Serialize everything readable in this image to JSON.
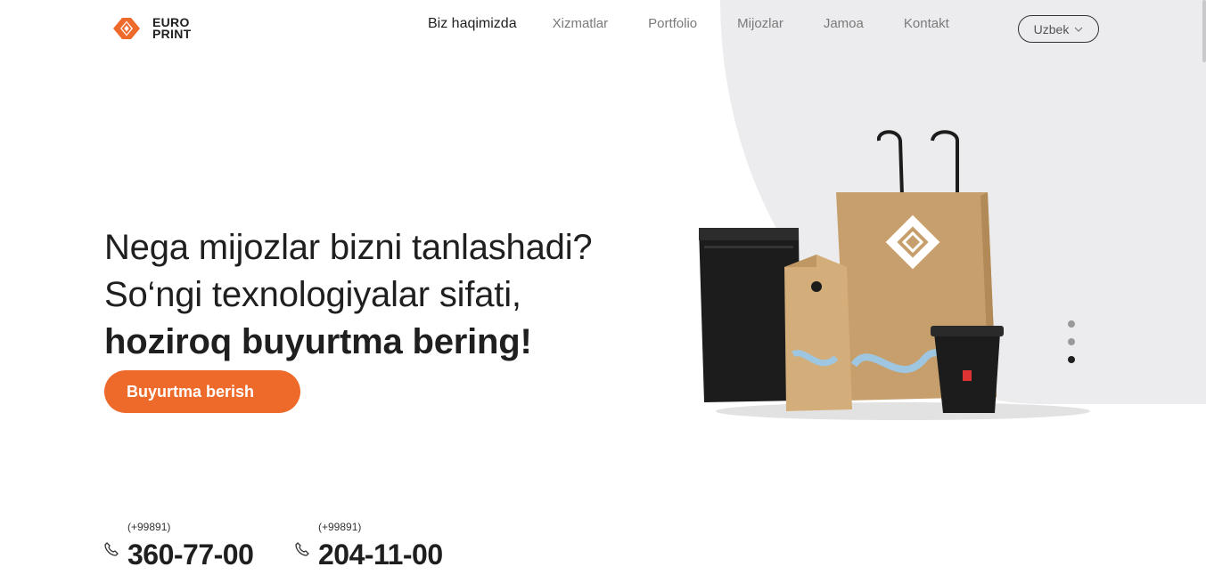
{
  "brand": {
    "line1": "EURO",
    "line2": "PRINT",
    "accent": "#ee6a2b"
  },
  "nav": {
    "items": [
      {
        "label": "Biz haqimizda",
        "active": true
      },
      {
        "label": "Xizmatlar",
        "active": false
      },
      {
        "label": "Portfolio",
        "active": false
      },
      {
        "label": "Mijozlar",
        "active": false
      },
      {
        "label": "Jamoa",
        "active": false
      },
      {
        "label": "Kontakt",
        "active": false
      }
    ]
  },
  "language": {
    "selected": "Uzbek",
    "icon": "chevron-down-icon"
  },
  "hero": {
    "line1": "Nega mijozlar bizni tanlashadi?",
    "line2": "So‘ngi texnologiyalar sifati,",
    "line3": "hoziroq buyurtma bering!"
  },
  "cta": {
    "label": "Buyurtma berish"
  },
  "phones": [
    {
      "prefix": "(+99891)",
      "number": "360-77-00",
      "icon": "phone-icon"
    },
    {
      "prefix": "(+99891)",
      "number": "204-11-00",
      "icon": "phone-icon"
    }
  ],
  "slider": {
    "count": 3,
    "active_index": 3
  },
  "colors": {
    "panel": "#ececee",
    "text": "#1f1f1f",
    "muted": "#7a7a7a"
  }
}
